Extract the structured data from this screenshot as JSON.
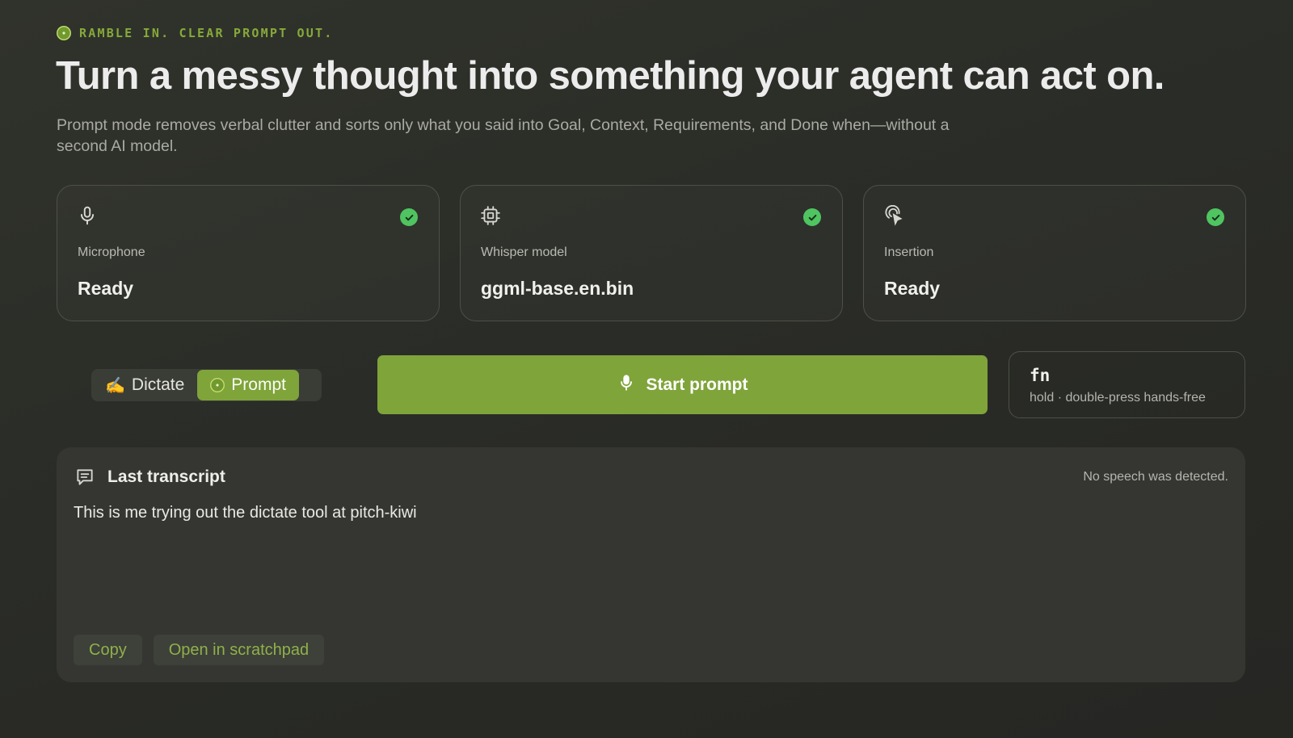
{
  "eyebrow": {
    "icon": "kiwi-icon",
    "text": "RAMBLE IN. CLEAR PROMPT OUT."
  },
  "headline": "Turn a messy thought into something your agent can act on.",
  "subtitle": "Prompt mode removes verbal clutter and sorts only what you said into Goal, Context, Requirements, and Done when—without a second AI model.",
  "status_cards": [
    {
      "icon": "microphone-icon",
      "label": "Microphone",
      "value": "Ready",
      "ok": true
    },
    {
      "icon": "chip-icon",
      "label": "Whisper model",
      "value": "ggml-base.en.bin",
      "ok": true
    },
    {
      "icon": "pointer-tap-icon",
      "label": "Insertion",
      "value": "Ready",
      "ok": true
    }
  ],
  "mode_toggle": {
    "options": [
      {
        "icon": "writing-hand-icon",
        "label": "Dictate",
        "active": false
      },
      {
        "icon": "kiwi-icon",
        "label": "Prompt",
        "active": true
      }
    ]
  },
  "start_button": {
    "icon": "microphone-icon",
    "label": "Start prompt"
  },
  "hotkey": {
    "key": "fn",
    "hint": "hold · double-press hands-free"
  },
  "transcript": {
    "icon": "message-icon",
    "title": "Last transcript",
    "status": "No speech was detected.",
    "text": "This is me trying out the dictate tool at pitch-kiwi",
    "actions": [
      "Copy",
      "Open in scratchpad"
    ]
  },
  "colors": {
    "accent": "#7fa43a",
    "success": "#4fc461",
    "background": "#2b2d28"
  }
}
